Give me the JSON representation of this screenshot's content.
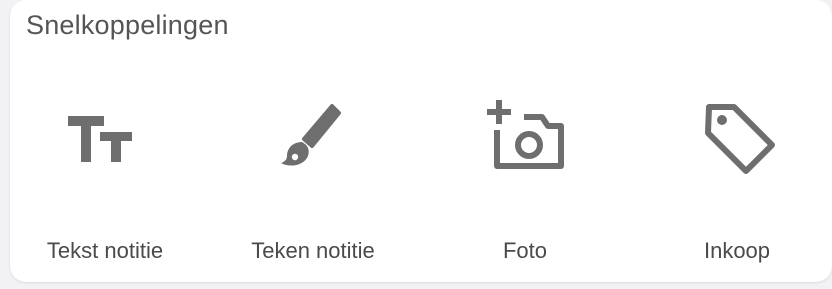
{
  "card": {
    "title": "Snelkoppelingen"
  },
  "shortcuts": [
    {
      "label": "Tekst notitie",
      "icon": "text-size-icon"
    },
    {
      "label": "Teken notitie",
      "icon": "paintbrush-icon"
    },
    {
      "label": "Foto",
      "icon": "add-camera-icon"
    },
    {
      "label": "Inkoop",
      "icon": "tag-icon"
    }
  ],
  "colors": {
    "icon": "#6e6e6e",
    "label": "#4a4a4a",
    "title": "#555555",
    "card_background": "#ffffff",
    "page_background": "#f2f2f4"
  }
}
